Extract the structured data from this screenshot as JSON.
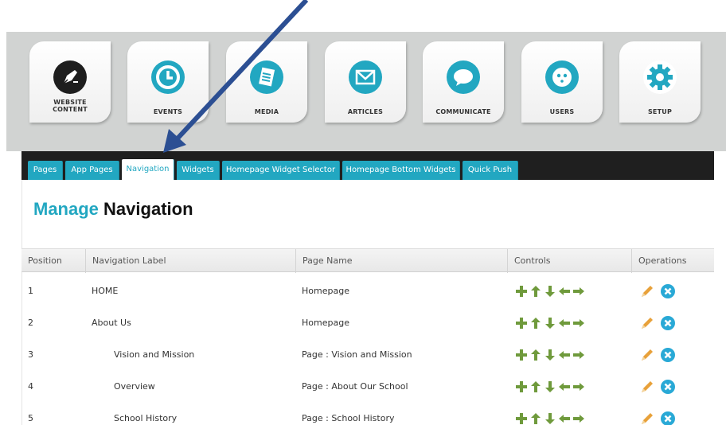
{
  "modules": [
    {
      "label_line1": "WEBSITE",
      "label_line2": "CONTENT",
      "icon": "pen-nib-icon"
    },
    {
      "label_line1": "EVENTS",
      "label_line2": "",
      "icon": "clock-icon"
    },
    {
      "label_line1": "MEDIA",
      "label_line2": "",
      "icon": "document-icon"
    },
    {
      "label_line1": "ARTICLES",
      "label_line2": "",
      "icon": "envelope-icon"
    },
    {
      "label_line1": "COMMUNICATE",
      "label_line2": "",
      "icon": "speech-bubble-icon"
    },
    {
      "label_line1": "USERS",
      "label_line2": "",
      "icon": "face-icon"
    },
    {
      "label_line1": "SETUP",
      "label_line2": "",
      "icon": "gear-icon"
    }
  ],
  "tabs": [
    "Pages",
    "App Pages",
    "Navigation",
    "Widgets",
    "Homepage Widget Selector",
    "Homepage Bottom Widgets",
    "Quick Push"
  ],
  "active_tab": "Navigation",
  "heading": {
    "part1": "Manage",
    "part2": "Navigation"
  },
  "table": {
    "columns": [
      "Position",
      "Navigation Label",
      "Page Name",
      "Controls",
      "Operations"
    ],
    "rows": [
      {
        "position": "1",
        "label": "HOME",
        "page": "Homepage",
        "indent": 0
      },
      {
        "position": "2",
        "label": "About Us",
        "page": "Homepage",
        "indent": 0
      },
      {
        "position": "3",
        "label": "Vision and Mission",
        "page": "Page : Vision and Mission",
        "indent": 1
      },
      {
        "position": "4",
        "label": "Overview",
        "page": "Page : About Our School",
        "indent": 1
      },
      {
        "position": "5",
        "label": "School History",
        "page": "Page : School History",
        "indent": 1
      }
    ]
  },
  "colors": {
    "accent": "#22a7c1",
    "tabbar": "#1f1f1f",
    "control_green": "#6f9a3c",
    "edit_orange": "#e8a13a",
    "delete_blue": "#29a9d6",
    "arrow": "#2c4f93"
  }
}
